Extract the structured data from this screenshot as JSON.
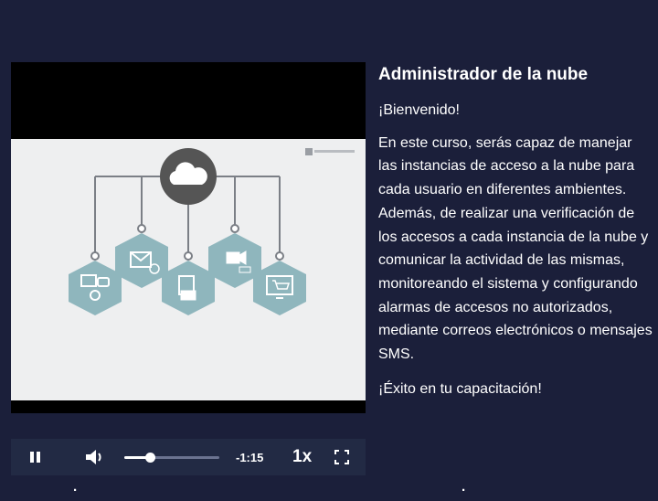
{
  "course": {
    "title": "Administrador de la nube",
    "welcome": "¡Bienvenido!",
    "description": "En este curso, serás capaz de manejar las instancias de acceso a la nube para cada usuario en diferentes ambientes. Además, de realizar una verificación de los accesos a cada instancia de la nube y comunicar la actividad de las mismas, monitoreando el sistema y configurando alarmas de accesos no autorizados, mediante correos electrónicos o mensajes SMS.",
    "closing": "¡Éxito en tu capacitación!"
  },
  "player": {
    "time_remaining": "-1:15",
    "speed": "1x",
    "progress": 0.27,
    "state": "playing",
    "colors": {
      "controls_bg": "#222a44",
      "hexagon": "#8fb6bd",
      "cloud_circle": "#555555"
    },
    "icons": [
      "pause-icon",
      "volume-icon",
      "fullscreen-icon",
      "cloud-icon",
      "mail-icon",
      "document-icon",
      "video-icon",
      "cart-icon",
      "devices-icon"
    ]
  },
  "theme": {
    "page_bg": "#1b1f3a",
    "text": "#ffffff"
  }
}
